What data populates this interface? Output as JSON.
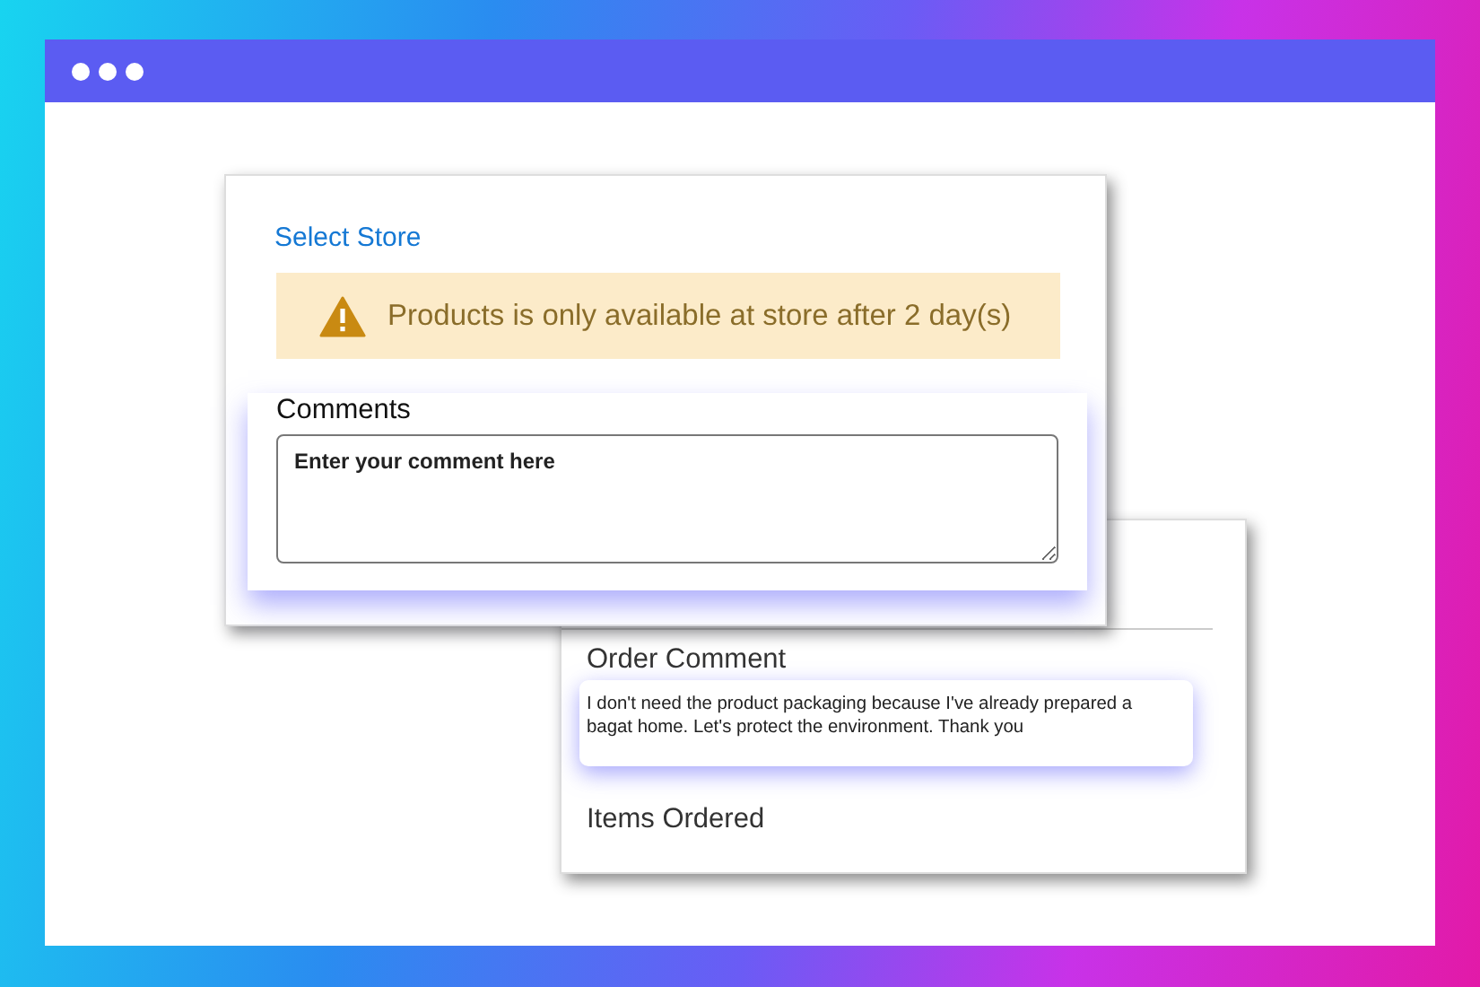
{
  "store_card": {
    "title": "Select Store",
    "alert": {
      "kind": "warning",
      "text": "Products is only available at store after 2 day(s)"
    },
    "comments": {
      "label": "Comments",
      "placeholder": "Enter your comment here"
    }
  },
  "order_card": {
    "order_comment": {
      "heading": "Order Comment",
      "text": "I don't need the product packaging because I've already prepared a bagat home. Let's protect the environment. Thank you"
    },
    "items_heading": "Items Ordered"
  }
}
